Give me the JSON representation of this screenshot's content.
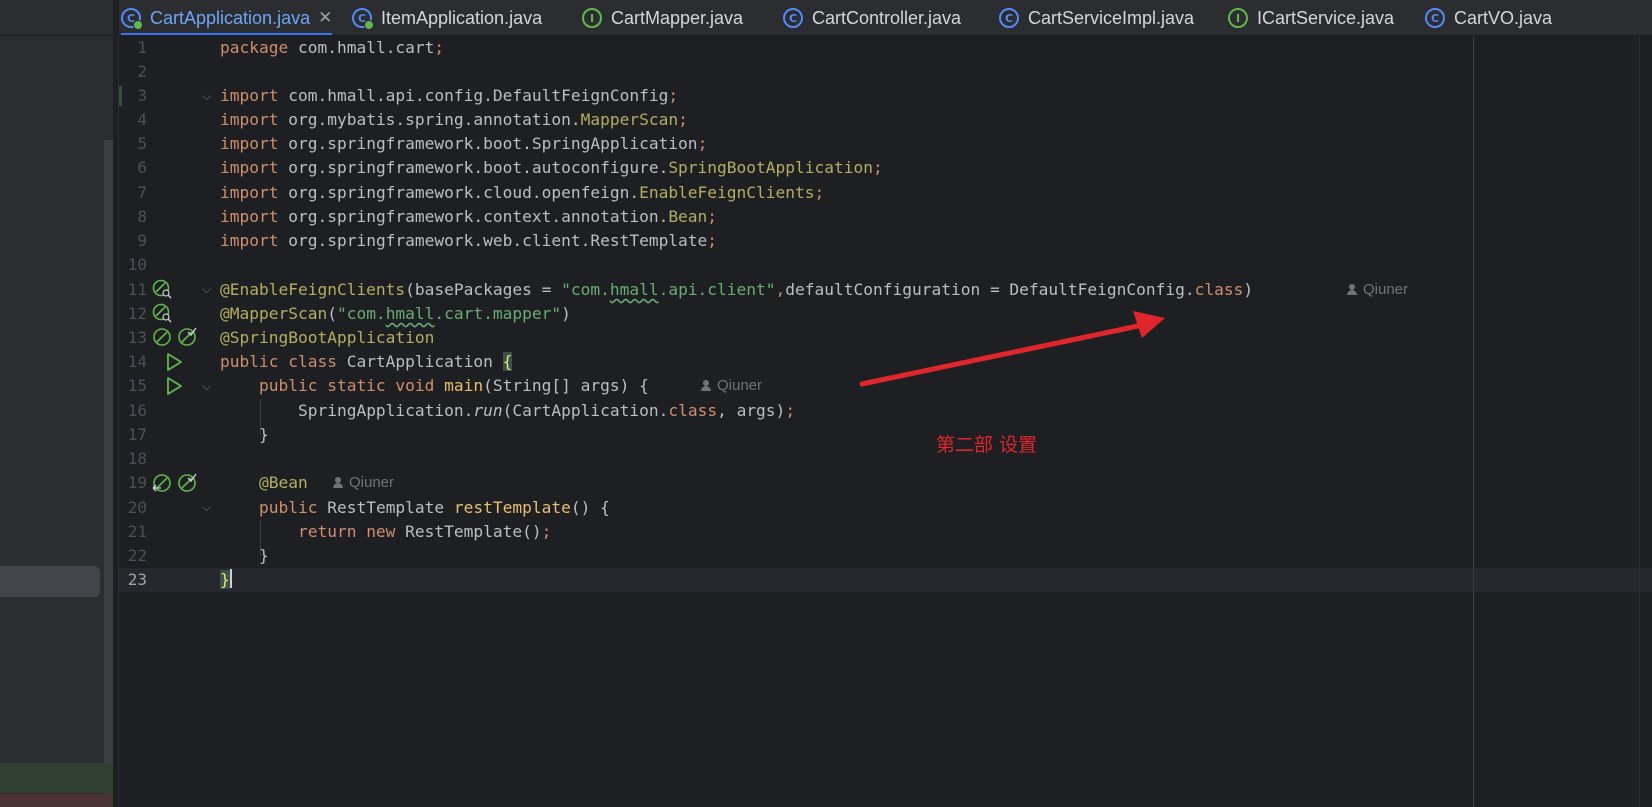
{
  "tabs": [
    {
      "label": "CartApplication.java",
      "icon": "spring-boot-app-class-icon",
      "active": true
    },
    {
      "label": "ItemApplication.java",
      "icon": "spring-boot-app-class-icon"
    },
    {
      "label": "CartMapper.java",
      "icon": "interface-icon"
    },
    {
      "label": "CartController.java",
      "icon": "class-icon"
    },
    {
      "label": "CartServiceImpl.java",
      "icon": "class-icon"
    },
    {
      "label": "ICartService.java",
      "icon": "interface-icon"
    },
    {
      "label": "CartVO.java",
      "icon": "class-icon"
    }
  ],
  "editor": {
    "line_numbers": [
      "1",
      "2",
      "3",
      "4",
      "5",
      "6",
      "7",
      "8",
      "9",
      "10",
      "11",
      "12",
      "13",
      "14",
      "15",
      "16",
      "17",
      "18",
      "19",
      "20",
      "21",
      "22",
      "23"
    ],
    "current_line": "23",
    "code": {
      "l1_kw": "package",
      "l1_rest": " com.hmall.cart",
      "l1_semi": ";",
      "import_kw": "import",
      "l3_rest": " com.hmall.api.config.DefaultFeignConfig",
      "l4_pkg": " org.mybatis.spring.annotation.",
      "l4_cls": "MapperScan",
      "l5_rest": " org.springframework.boot.SpringApplication",
      "l6_pkg": " org.springframework.boot.autoconfigure.",
      "l6_cls": "SpringBootApplication",
      "l7_pkg": " org.springframework.cloud.openfeign.",
      "l7_cls": "EnableFeignClients",
      "l8_pkg": " org.springframework.context.annotation.",
      "l8_cls": "Bean",
      "l9_rest": " org.springframework.web.client.RestTemplate",
      "semi": ";",
      "l11_ann": "@EnableFeignClients",
      "l11_a": "(basePackages = ",
      "l11_s1": "\"com.",
      "l11_s2": "hmall",
      "l11_s3": ".api.client\"",
      "l11_comma": ",",
      "l11_b": "defaultConfiguration = DefaultFeignConfig.",
      "l11_class": "class",
      "l11_c": ")",
      "l12_ann": "@MapperScan",
      "l12_a": "(",
      "l12_s1": "\"com.",
      "l12_s2": "hmall",
      "l12_s3": ".cart.mapper\"",
      "l12_c": ")",
      "l13_ann": "@SpringBootApplication",
      "l14_kw": "public class",
      "l14_name": " CartApplication ",
      "l14_brace": "{",
      "l15_kw": "public static void",
      "l15_fn": " main",
      "l15_rest": "(String[] args) {",
      "l16_a": "SpringApplication.",
      "l16_fn": "run",
      "l16_b": "(CartApplication.",
      "l16_kw": "class",
      "l16_c": ", args)",
      "l16_semi": ";",
      "close_brace": "}",
      "l19_ann": "@Bean",
      "l20_kw": "public",
      "l20_type": " RestTemplate ",
      "l20_fn": "restTemplate",
      "l20_rest": "() {",
      "l21_kw": "return new",
      "l21_rest": " RestTemplate()",
      "l21_semi": ";",
      "l23_brace": "}"
    },
    "authors": {
      "line11": "Qiuner",
      "line15": "Qiuner",
      "line19": "Qiuner"
    }
  },
  "annotation_note": "第二部 设置",
  "colors": {
    "arrow": "#e0262b",
    "active_tab": "#3574f0"
  }
}
